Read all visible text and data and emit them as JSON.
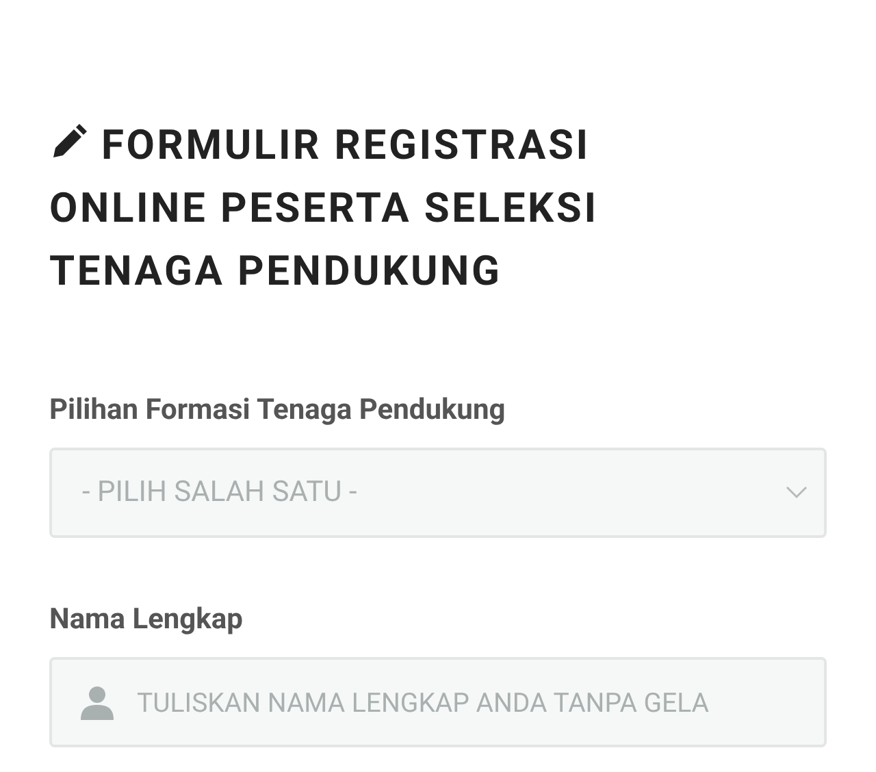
{
  "title": "FORMULIR REGISTRASI ONLINE PESERTA SELEKSI TENAGA PENDUKUNG",
  "fields": [
    {
      "kind": "select",
      "label": "Pilihan Formasi Tenaga Pendukung",
      "placeholder": "- PILIH SALAH SATU -"
    },
    {
      "kind": "text",
      "label": "Nama Lengkap",
      "placeholder": "TULISKAN NAMA LENGKAP ANDA TANPA GELA"
    }
  ]
}
